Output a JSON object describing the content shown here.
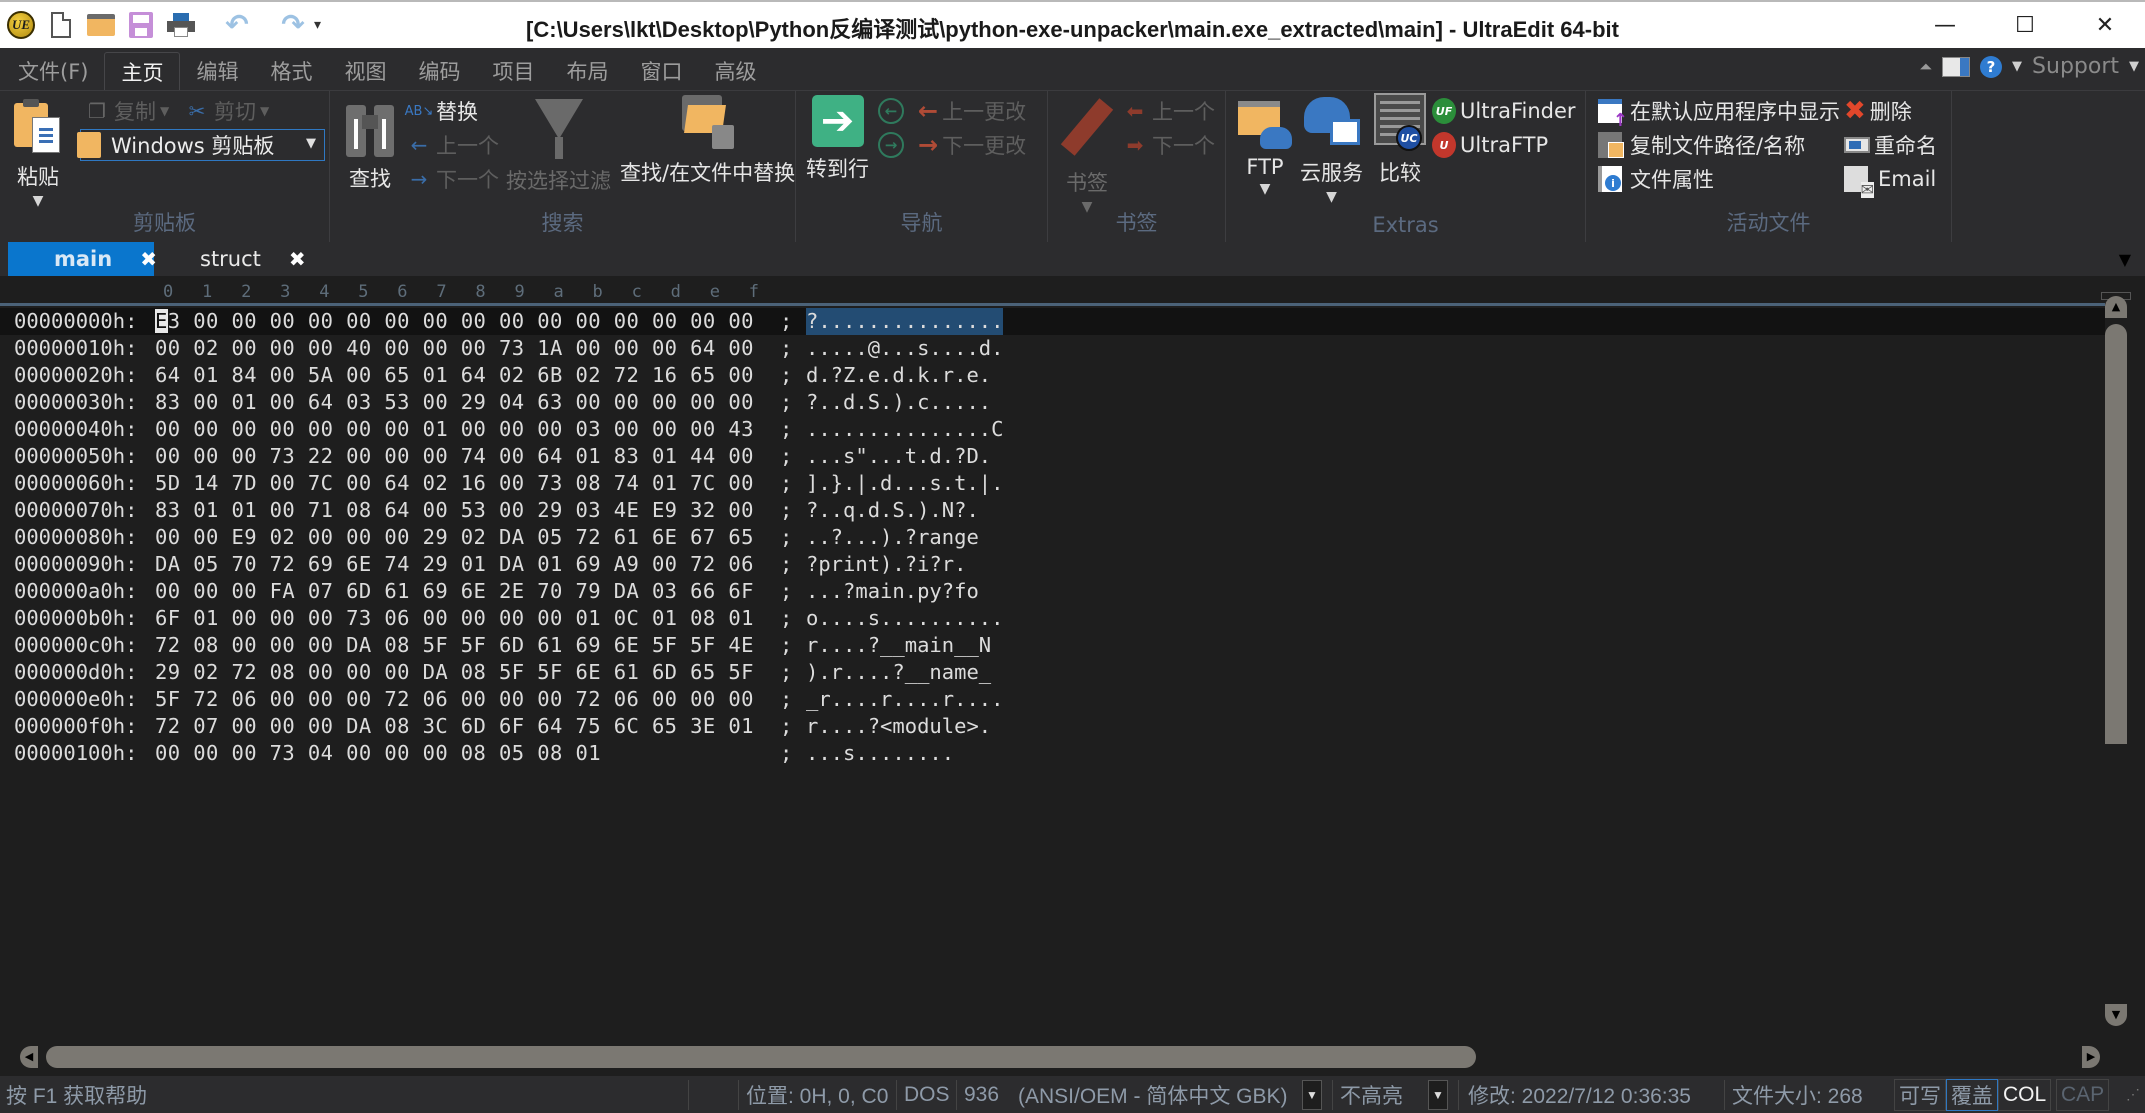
{
  "app": {
    "title": "[C:\\Users\\lkt\\Desktop\\Python反编译测试\\python-exe-unpacker\\main.exe_extracted\\main] - UltraEdit 64-bit",
    "logo_text": "UE",
    "window_controls": {
      "minimize": "—",
      "maximize": "☐",
      "close": "✕"
    }
  },
  "quick_access": [
    "new-file",
    "open-folder",
    "save",
    "print",
    "undo",
    "redo",
    "customize"
  ],
  "menu": {
    "items": [
      {
        "label": "文件(F)",
        "active": false
      },
      {
        "label": "主页",
        "active": true
      },
      {
        "label": "编辑",
        "active": false
      },
      {
        "label": "格式",
        "active": false
      },
      {
        "label": "视图",
        "active": false
      },
      {
        "label": "编码",
        "active": false
      },
      {
        "label": "项目",
        "active": false
      },
      {
        "label": "布局",
        "active": false
      },
      {
        "label": "窗口",
        "active": false
      },
      {
        "label": "高级",
        "active": false
      }
    ],
    "support_label": "Support",
    "help_icon_text": "?"
  },
  "ribbon": {
    "clipboard": {
      "group_label": "剪贴板",
      "paste": "粘贴",
      "copy": "复制",
      "cut": "剪切",
      "clipboard_select": "Windows 剪贴板"
    },
    "search": {
      "group_label": "搜索",
      "find": "查找",
      "replace": "替换",
      "prev": "上一个",
      "next": "下一个",
      "filter": "按选择过滤",
      "find_in_files": "查找/在文件中替换"
    },
    "navigation": {
      "group_label": "导航",
      "goto_line": "转到行",
      "prev_change": "上一更改",
      "next_change": "下一更改"
    },
    "bookmarks": {
      "group_label": "书签",
      "bookmark": "书签",
      "prev": "上一个",
      "next": "下一个"
    },
    "extras": {
      "group_label": "Extras",
      "ftp": "FTP",
      "cloud": "云服务",
      "compare": "比较",
      "ultrafinder": "UltraFinder",
      "ultraftp": "UltraFTP",
      "uc_badge": "UC",
      "uf_badge": "UF",
      "uftp_badge": "U"
    },
    "active_file": {
      "group_label": "活动文件",
      "show_default_app": "在默认应用程序中显示",
      "copy_path": "复制文件路径/名称",
      "properties": "文件属性",
      "delete": "删除",
      "rename": "重命名",
      "email": "Email"
    }
  },
  "tabs": [
    {
      "label": "main",
      "active": true,
      "close": "✖"
    },
    {
      "label": "struct",
      "active": false,
      "close": "✖"
    }
  ],
  "hex": {
    "ruler": [
      "0",
      "1",
      "2",
      "3",
      "4",
      "5",
      "6",
      "7",
      "8",
      "9",
      "a",
      "b",
      "c",
      "d",
      "e",
      "f"
    ],
    "rows": [
      {
        "addr": "00000000h:",
        "bytes": "E3 00 00 00 00 00 00 00 00 00 00 00 00 00 00 00",
        "ascii": "?..............."
      },
      {
        "addr": "00000010h:",
        "bytes": "00 02 00 00 00 40 00 00 00 73 1A 00 00 00 64 00",
        "ascii": ".....@...s....d."
      },
      {
        "addr": "00000020h:",
        "bytes": "64 01 84 00 5A 00 65 01 64 02 6B 02 72 16 65 00",
        "ascii": "d.?Z.e.d.k.r.e."
      },
      {
        "addr": "00000030h:",
        "bytes": "83 00 01 00 64 03 53 00 29 04 63 00 00 00 00 00",
        "ascii": "?..d.S.).c....."
      },
      {
        "addr": "00000040h:",
        "bytes": "00 00 00 00 00 00 00 01 00 00 00 03 00 00 00 43",
        "ascii": "...............C"
      },
      {
        "addr": "00000050h:",
        "bytes": "00 00 00 73 22 00 00 00 74 00 64 01 83 01 44 00",
        "ascii": "...s\"...t.d.?D."
      },
      {
        "addr": "00000060h:",
        "bytes": "5D 14 7D 00 7C 00 64 02 16 00 73 08 74 01 7C 00",
        "ascii": "].}.|.d...s.t.|."
      },
      {
        "addr": "00000070h:",
        "bytes": "83 01 01 00 71 08 64 00 53 00 29 03 4E E9 32 00",
        "ascii": "?..q.d.S.).N?."
      },
      {
        "addr": "00000080h:",
        "bytes": "00 00 E9 02 00 00 00 29 02 DA 05 72 61 6E 67 65",
        "ascii": "..?...).?range"
      },
      {
        "addr": "00000090h:",
        "bytes": "DA 05 70 72 69 6E 74 29 01 DA 01 69 A9 00 72 06",
        "ascii": "?print).?i?r."
      },
      {
        "addr": "000000a0h:",
        "bytes": "00 00 00 FA 07 6D 61 69 6E 2E 70 79 DA 03 66 6F",
        "ascii": "...?main.py?fo"
      },
      {
        "addr": "000000b0h:",
        "bytes": "6F 01 00 00 00 73 06 00 00 00 00 01 0C 01 08 01",
        "ascii": "o....s.........."
      },
      {
        "addr": "000000c0h:",
        "bytes": "72 08 00 00 00 DA 08 5F 5F 6D 61 69 6E 5F 5F 4E",
        "ascii": "r....?__main__N"
      },
      {
        "addr": "000000d0h:",
        "bytes": "29 02 72 08 00 00 00 DA 08 5F 5F 6E 61 6D 65 5F",
        "ascii": ").r....?__name_"
      },
      {
        "addr": "000000e0h:",
        "bytes": "5F 72 06 00 00 00 72 06 00 00 00 72 06 00 00 00",
        "ascii": "_r....r....r...."
      },
      {
        "addr": "000000f0h:",
        "bytes": "72 07 00 00 00 DA 08 3C 6D 6F 64 75 6C 65 3E 01",
        "ascii": "r....?<module>."
      },
      {
        "addr": "00000100h:",
        "bytes": "00 00 00 73 04 00 00 00 08 05 08 01            ",
        "ascii": "...s........"
      }
    ],
    "separator": ";"
  },
  "statusbar": {
    "help": "按 F1 获取帮助",
    "position": "位置: 0H, 0, C0",
    "line_ending": "DOS",
    "codepage": "936",
    "encoding": "(ANSI/OEM - 简体中文 GBK)",
    "highlight": "不高亮",
    "modified": "修改:   2022/7/12 0:36:35",
    "filesize": "文件大小:   268",
    "writable": "可写",
    "overwrite": "覆盖",
    "col": "COL",
    "cap": "CAP"
  },
  "colors": {
    "accent": "#0a76cd",
    "selection": "#234c73",
    "background": "#1e1e1e",
    "ribbon": "#2c2c2e",
    "goto_green": "#3fb184",
    "delete_red": "#e2472b"
  }
}
